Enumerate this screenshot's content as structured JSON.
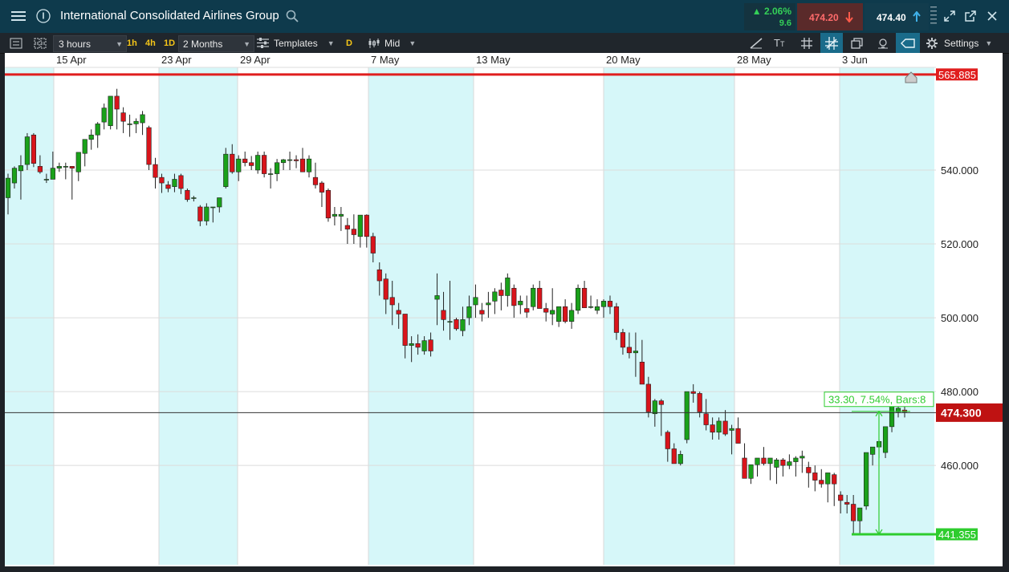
{
  "titlebar": {
    "instrument": "International Consolidated Airlines Group",
    "change_pct": "2.06%",
    "change_abs": "9.6",
    "sell_price": "474.20",
    "buy_price": "474.40"
  },
  "toolbar": {
    "interval": "3 hours",
    "quick_1h": "1h",
    "quick_4h": "4h",
    "quick_1d": "1D",
    "range": "2 Months",
    "templates": "Templates",
    "d_button": "D",
    "price_type": "Mid",
    "settings": "Settings"
  },
  "chart_data": {
    "type": "candlestick",
    "x_labels": [
      "15 Apr",
      "23 Apr",
      "29 Apr",
      "7 May",
      "13 May",
      "20 May",
      "28 May",
      "3 Jun"
    ],
    "y_ticks": [
      "540.000",
      "520.000",
      "500.000",
      "480.000",
      "460.000"
    ],
    "ylim": [
      433.1,
      567.8
    ],
    "resistance_label": "565.885",
    "support_label": "441.355",
    "current_price_label": "474.300",
    "measure_label": "33.30, 7.54%, Bars:8",
    "candles": [
      [
        532.5,
        539,
        528,
        537.8
      ],
      [
        536.5,
        541,
        535,
        540.5
      ],
      [
        539.8,
        544,
        532,
        541.2
      ],
      [
        541.5,
        550,
        540,
        549
      ],
      [
        549.5,
        550,
        540.8,
        541.8
      ],
      [
        541,
        544,
        539,
        539.5
      ],
      [
        537.5,
        539,
        536.5,
        537.5
      ],
      [
        537.5,
        545,
        537.5,
        540.5
      ],
      [
        540.5,
        542,
        539.5,
        541
      ],
      [
        540.8,
        542,
        537.5,
        541
      ],
      [
        541,
        541,
        532,
        540.5
      ],
      [
        539.5,
        543,
        537,
        544.8
      ],
      [
        544.5,
        547,
        541,
        548.3
      ],
      [
        548.3,
        551,
        545.5,
        549.5
      ],
      [
        549.5,
        553,
        546,
        552.5
      ],
      [
        553,
        558,
        551,
        556.8
      ],
      [
        552,
        560,
        551,
        560
      ],
      [
        560,
        562,
        551,
        556.5
      ],
      [
        555.5,
        557,
        550,
        553.2
      ],
      [
        552.5,
        555,
        549,
        552.5
      ],
      [
        552.5,
        554,
        550,
        553.2
      ],
      [
        552.8,
        556,
        549.5,
        555
      ],
      [
        551.5,
        552,
        540,
        541.5
      ],
      [
        541.5,
        543.3,
        535,
        538
      ],
      [
        538,
        539,
        533.8,
        536.5
      ],
      [
        536,
        537,
        534,
        535
      ],
      [
        535.5,
        539,
        534,
        537.5
      ],
      [
        538.5,
        539,
        533.5,
        535
      ],
      [
        534.5,
        535,
        531.4,
        532
      ],
      [
        532.5,
        533,
        531.5,
        532.5
      ],
      [
        530,
        530.5,
        524.8,
        526.2
      ],
      [
        526.2,
        531,
        525,
        530
      ],
      [
        530,
        530,
        525.8,
        530
      ],
      [
        530,
        532,
        528.5,
        532.5
      ],
      [
        535.5,
        546,
        535,
        544.3
      ],
      [
        544.3,
        547,
        539,
        539.5
      ],
      [
        539.5,
        544,
        537,
        543
      ],
      [
        543,
        545,
        541,
        542
      ],
      [
        542,
        543.8,
        540,
        541.2
      ],
      [
        540,
        545,
        539,
        544
      ],
      [
        544,
        545,
        538,
        539
      ],
      [
        539,
        540.5,
        535,
        539
      ],
      [
        539,
        543,
        537,
        542
      ],
      [
        542,
        543,
        540,
        542.8
      ],
      [
        542.8,
        545,
        540,
        542.8
      ],
      [
        542.8,
        544,
        540.5,
        542.5
      ],
      [
        543,
        546,
        541,
        539.5
      ],
      [
        539.5,
        544,
        538,
        543
      ],
      [
        538,
        542,
        535,
        536
      ],
      [
        536.5,
        537,
        530,
        534
      ],
      [
        534.5,
        535,
        526,
        527
      ],
      [
        527.5,
        530,
        525,
        528
      ],
      [
        527.5,
        530,
        523.5,
        528
      ],
      [
        525,
        527,
        520,
        524
      ],
      [
        524,
        528,
        520,
        522.5
      ],
      [
        522,
        525,
        519,
        527.8
      ],
      [
        527.8,
        528,
        519,
        522
      ],
      [
        522,
        523,
        515,
        517.5
      ],
      [
        513,
        515,
        506,
        510
      ],
      [
        510.5,
        512,
        501,
        505
      ],
      [
        505.5,
        510,
        498,
        503.5
      ],
      [
        502,
        504,
        497,
        501
      ],
      [
        501,
        501,
        489,
        492.5
      ],
      [
        492.5,
        495,
        488,
        493
      ],
      [
        493,
        495.5,
        490,
        492
      ],
      [
        491,
        495,
        490,
        493.8
      ],
      [
        494,
        496,
        489.5,
        491
      ],
      [
        505,
        512,
        498,
        506
      ],
      [
        502,
        507,
        496.5,
        499.5
      ],
      [
        499,
        510,
        494,
        499
      ],
      [
        499.5,
        500,
        496.5,
        497
      ],
      [
        496.5,
        503,
        495,
        499.5
      ],
      [
        500,
        506,
        498,
        503
      ],
      [
        503.5,
        509,
        500,
        505.5
      ],
      [
        502,
        504,
        499,
        501
      ],
      [
        503.5,
        507,
        500,
        504
      ],
      [
        504.5,
        508,
        501,
        507
      ],
      [
        507.5,
        509.5,
        502,
        506
      ],
      [
        506,
        512,
        503,
        510.8
      ],
      [
        508,
        509,
        500,
        503.3
      ],
      [
        503.5,
        506,
        501,
        504.5
      ],
      [
        502.5,
        506,
        500,
        501.5
      ],
      [
        503,
        509,
        502,
        508
      ],
      [
        508,
        510,
        505,
        502.5
      ],
      [
        502.5,
        504,
        499,
        501.5
      ],
      [
        501,
        508,
        498,
        502
      ],
      [
        499,
        503,
        497.5,
        503
      ],
      [
        503,
        505,
        498.5,
        499
      ],
      [
        499,
        504,
        497,
        502
      ],
      [
        502,
        509,
        501,
        508
      ],
      [
        508,
        510,
        503,
        502.7
      ],
      [
        503,
        506,
        502.5,
        503
      ],
      [
        502,
        505,
        501,
        503
      ],
      [
        503,
        505,
        500,
        504.5
      ],
      [
        504.5,
        506,
        501,
        503
      ],
      [
        503,
        504,
        494,
        496
      ],
      [
        496,
        497,
        490,
        492
      ],
      [
        492,
        496,
        489,
        490.5
      ],
      [
        490.5,
        496,
        484,
        491
      ],
      [
        488,
        494,
        482,
        482
      ],
      [
        482,
        484,
        473,
        474.5
      ],
      [
        474,
        478,
        470.5,
        477.5
      ],
      [
        477.5,
        478,
        468,
        476.5
      ],
      [
        469,
        469.5,
        461,
        464.5
      ],
      [
        464.5,
        466,
        461.5,
        460.5
      ],
      [
        460.5,
        464,
        460,
        463
      ],
      [
        467,
        478,
        466,
        480
      ],
      [
        480,
        482,
        477,
        479.5
      ],
      [
        479.5,
        480,
        473,
        474.5
      ],
      [
        474,
        478,
        469.5,
        471
      ],
      [
        471,
        473,
        467,
        469
      ],
      [
        469,
        473,
        467,
        472
      ],
      [
        472,
        475,
        468,
        468.5
      ],
      [
        469.5,
        471,
        463,
        470
      ],
      [
        470,
        473,
        466,
        466
      ],
      [
        462,
        466,
        457.5,
        456.5
      ],
      [
        456.5,
        460,
        455,
        460.2
      ],
      [
        460.2,
        462,
        457,
        462
      ],
      [
        462,
        465,
        460,
        460.5
      ],
      [
        460.5,
        462,
        456,
        462
      ],
      [
        459.5,
        462,
        455,
        461.5
      ],
      [
        461.5,
        462,
        457,
        460
      ],
      [
        460,
        463,
        459,
        461
      ],
      [
        461,
        462.5,
        457,
        462
      ],
      [
        462,
        464,
        458,
        462.5
      ],
      [
        459.5,
        461,
        454,
        458
      ],
      [
        458,
        460,
        453,
        456
      ],
      [
        456,
        459,
        454,
        455
      ],
      [
        455,
        457,
        450,
        458
      ],
      [
        457.5,
        458,
        449,
        455
      ],
      [
        452,
        453,
        447,
        450.5
      ],
      [
        450,
        452,
        447,
        449.5
      ],
      [
        449.5,
        452,
        441.4,
        445
      ],
      [
        445,
        447,
        441.5,
        448.5
      ],
      [
        449,
        460.5,
        448,
        463.5
      ],
      [
        463,
        465,
        460,
        465
      ],
      [
        465,
        467,
        462,
        466.5
      ],
      [
        463.5,
        469,
        462,
        470.5
      ],
      [
        470.5,
        474,
        469,
        476.5
      ],
      [
        474.5,
        476,
        473,
        475.5
      ],
      [
        475,
        477.5,
        473,
        474.5
      ]
    ]
  }
}
